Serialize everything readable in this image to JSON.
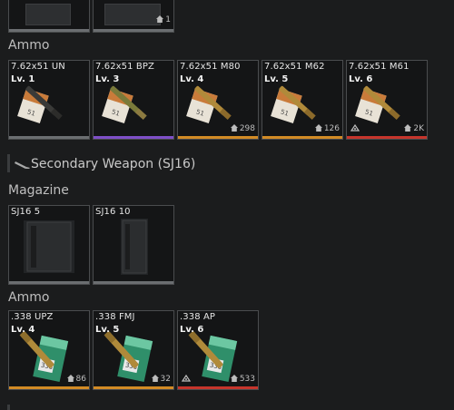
{
  "top_row": {
    "cards": [
      {
        "count": ""
      },
      {
        "count": "1"
      }
    ]
  },
  "sections": {
    "ammo_1": "Ammo",
    "secondary_weapon": "Secondary Weapon (SJ16)",
    "magazine": "Magazine",
    "ammo_2": "Ammo"
  },
  "ammo_762": [
    {
      "name": "7.62x51 UN",
      "level": "Lv. 1",
      "count": "",
      "bar_color": "#6b6e71",
      "locked": false
    },
    {
      "name": "7.62x51 BPZ",
      "level": "Lv. 3",
      "count": "",
      "bar_color": "#7e4fc7",
      "locked": false
    },
    {
      "name": "7.62x51 M80",
      "level": "Lv. 4",
      "count": "298",
      "bar_color": "#d28b25",
      "locked": false
    },
    {
      "name": "7.62x51 M62",
      "level": "Lv. 5",
      "count": "126",
      "bar_color": "#d28b25",
      "locked": false
    },
    {
      "name": "7.62x51 M61",
      "level": "Lv. 6",
      "count": "2K",
      "bar_color": "#c6352c",
      "locked": true
    }
  ],
  "magazines": [
    {
      "name": "SJ16 5"
    },
    {
      "name": "SJ16 10"
    }
  ],
  "ammo_338": [
    {
      "name": ".338 UPZ",
      "level": "Lv. 4",
      "count": "86",
      "bar_color": "#d28b25",
      "locked": false
    },
    {
      "name": ".338 FMJ",
      "level": "Lv. 5",
      "count": "32",
      "bar_color": "#d28b25",
      "locked": false
    },
    {
      "name": ".338 AP",
      "level": "Lv. 6",
      "count": "533",
      "bar_color": "#c6352c",
      "locked": true
    }
  ],
  "colors": {
    "background": "#1b1c1d",
    "card_border": "#4a4c4e",
    "gray_bar": "#6b6e71",
    "purple_bar": "#7e4fc7",
    "orange_bar": "#d28b25",
    "red_bar": "#c6352c"
  },
  "icons": {
    "home": "home-icon",
    "lock": "lock-icon",
    "weapon": "rifle-icon"
  }
}
